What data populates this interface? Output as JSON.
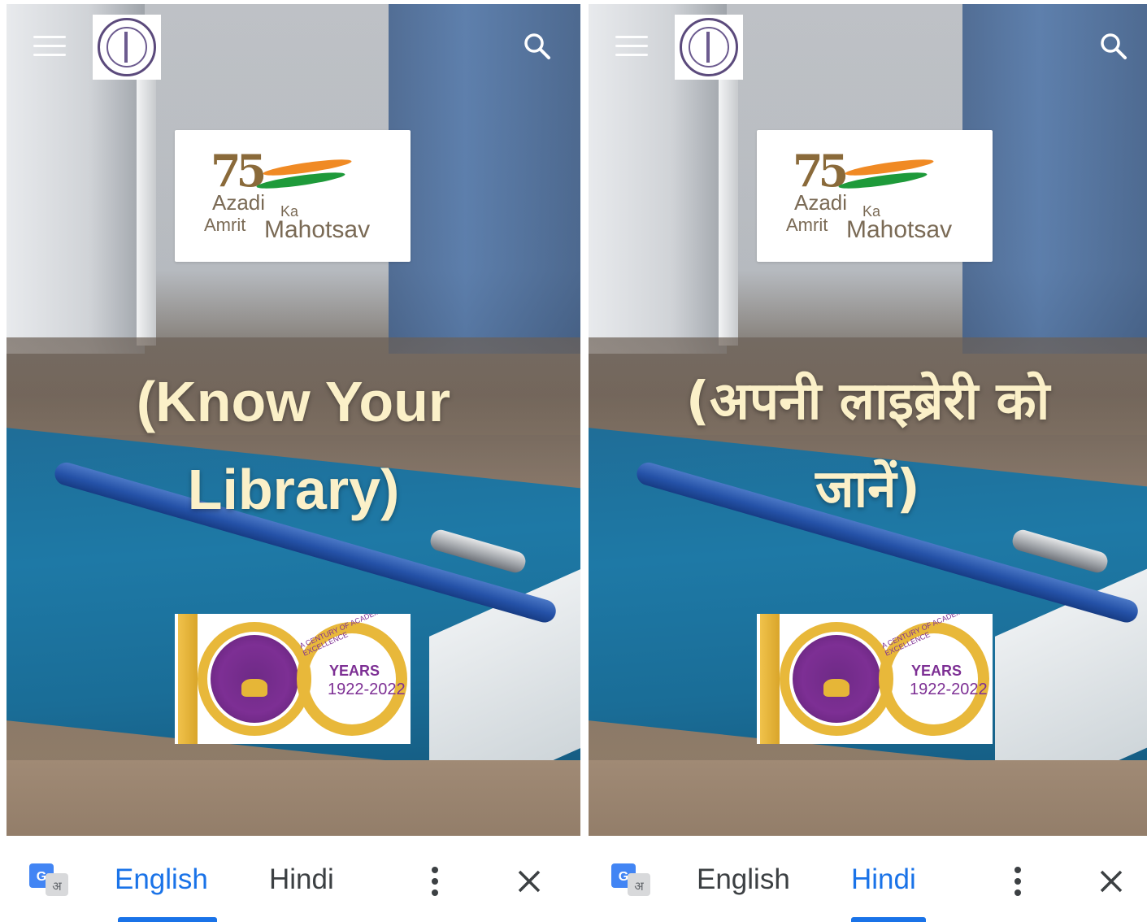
{
  "panels": [
    {
      "headline_line1": "(Know Your",
      "headline_line2": "Library)",
      "translate_bar": {
        "lang_source": "English",
        "lang_target": "Hindi",
        "active": "English"
      }
    },
    {
      "headline_line1": "(अपनी लाइब्रेरी को",
      "headline_line2": "जानें)",
      "translate_bar": {
        "lang_source": "English",
        "lang_target": "Hindi",
        "active": "Hindi"
      }
    }
  ],
  "azadi_logo": {
    "line1": "Azadi",
    "ka": "Ka",
    "amrit": "Amrit",
    "mahotsav": "Mahotsav"
  },
  "du_logo": {
    "years": "YEARS",
    "range": "1922-2022",
    "arc_text": "A CENTURY OF ACADEMIC EXCELLENCE"
  },
  "colors": {
    "accent": "#1a73e8",
    "headline": "#fbf0c8",
    "icon": "#3c4043"
  },
  "icons": [
    "menu-icon",
    "search-icon",
    "google-translate-icon",
    "more-vert-icon",
    "close-icon"
  ]
}
